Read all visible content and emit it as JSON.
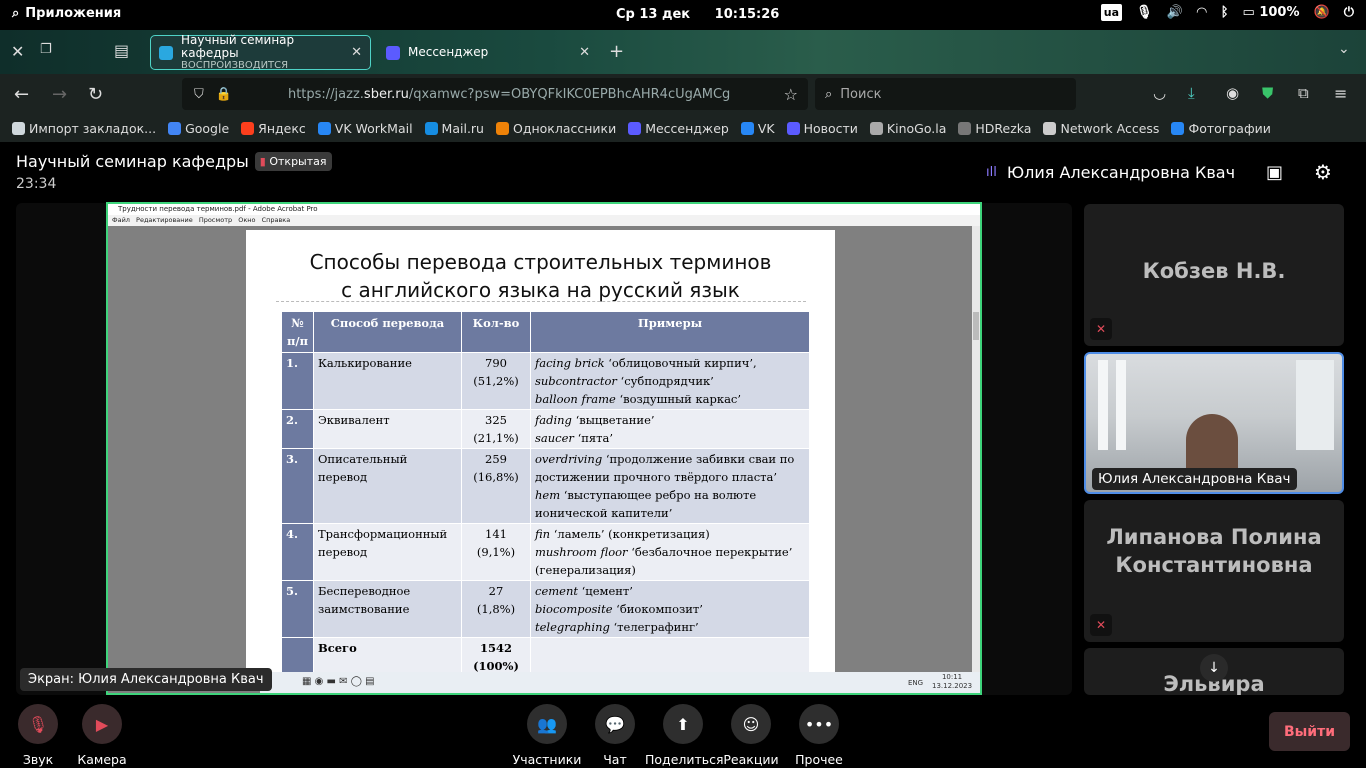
{
  "system": {
    "apps_label": "Приложения",
    "date": "Ср 13 дек",
    "time": "10:15:26",
    "keyboard": "ua",
    "battery": "100%"
  },
  "browser": {
    "tabs": [
      {
        "title": "Научный семинар кафедры",
        "subtitle": "ВОСПРОИЗВОДИТСЯ"
      },
      {
        "title": "Мессенджер",
        "subtitle": ""
      }
    ],
    "url_prefix": "https://jazz.",
    "url_domain": "sber.ru",
    "url_path": "/qxamwc?psw=OBYQFkIKC0EPBhcAHR4cUgAMCg",
    "search_placeholder": "Поиск",
    "bookmarks": [
      {
        "label": "Импорт закладок...",
        "color": "#cfd8dc"
      },
      {
        "label": "Google",
        "color": "#4285f4"
      },
      {
        "label": "Яндекс",
        "color": "#fc3f1d"
      },
      {
        "label": "VK WorkMail",
        "color": "#2787f5"
      },
      {
        "label": "Mail.ru",
        "color": "#168de2"
      },
      {
        "label": "Одноклассники",
        "color": "#ee8208"
      },
      {
        "label": "Мессенджер",
        "color": "#5b5bff"
      },
      {
        "label": "VK",
        "color": "#2787f5"
      },
      {
        "label": "Новости",
        "color": "#5b5bff"
      },
      {
        "label": "KinoGo.la",
        "color": "#aaaaaa"
      },
      {
        "label": "HDRezka",
        "color": "#777777"
      },
      {
        "label": "Network Access",
        "color": "#cccccc"
      },
      {
        "label": "Фотографии",
        "color": "#2787f5"
      }
    ]
  },
  "meeting": {
    "title": "Научный семинар кафедры",
    "badge": "Открытая",
    "elapsed": "23:34",
    "active_speaker": "Юлия Александровна Квач",
    "screen_label": "Экран: Юлия Александровна Квач"
  },
  "shared_doc": {
    "window_title": "Трудности перевода терминов.pdf - Adobe Acrobat Pro",
    "menu": "Файл Редактирование Просмотр Окно Справка",
    "slide_title_line1": "Способы перевода строительных терминов",
    "slide_title_line2": "с английского языка на русский язык",
    "headers": [
      "№ п/п",
      "Способ перевода",
      "Кол-во",
      "Примеры"
    ],
    "rows": [
      {
        "num": "1.",
        "method": "Калькирование",
        "count": "790",
        "percent": "(51,2%)",
        "examples": [
          [
            "facing brick",
            " ‘облицовочный кирпич’,"
          ],
          [
            "subcontractor",
            " ‘субподрядчик’"
          ],
          [
            "balloon frame",
            " ‘воздушный каркас’"
          ]
        ]
      },
      {
        "num": "2.",
        "method": "Эквивалент",
        "count": "325",
        "percent": "(21,1%)",
        "examples": [
          [
            "fading",
            " ‘выцветание’"
          ],
          [
            "saucer",
            " ‘пята’"
          ]
        ]
      },
      {
        "num": "3.",
        "method": "Описательный перевод",
        "count": "259",
        "percent": "(16,8%)",
        "examples": [
          [
            "overdriving",
            " ‘продолжение забивки сваи по достижении прочного твёрдого пласта’"
          ],
          [
            "hem",
            " ‘выступающее ребро на волюте ионической капители’"
          ]
        ]
      },
      {
        "num": "4.",
        "method": "Трансформационный перевод",
        "count": "141",
        "percent": "(9,1%)",
        "examples": [
          [
            "fin",
            " ‘ламель’ (конкретизация)"
          ],
          [
            "mushroom floor",
            " ‘безбалочное перекрытие’ (генерализация)"
          ]
        ]
      },
      {
        "num": "5.",
        "method": "Беспереводное заимствование",
        "count": "27",
        "percent": "(1,8%)",
        "examples": [
          [
            "cement",
            " ‘цемент’"
          ],
          [
            "biocomposite",
            " ‘биокомпозит’"
          ],
          [
            "telegraphing",
            " ‘телеграфинг’"
          ]
        ]
      },
      {
        "num": "",
        "method": "Всего",
        "count": "1542",
        "percent": "(100%)",
        "examples": []
      }
    ],
    "taskbar_lang": "ENG",
    "taskbar_time": "10:11",
    "taskbar_date": "13.12.2023"
  },
  "participants": [
    {
      "name": "Кобзев Н.В.",
      "muted": true
    },
    {
      "name": "Юлия Александровна Квач",
      "video": true
    },
    {
      "name": "Липанова Полина Константиновна",
      "muted": true
    },
    {
      "name": "Эльвира",
      "muted": false
    }
  ],
  "controls": [
    {
      "label": "Звук",
      "icon": "mic-off-icon",
      "state": "off"
    },
    {
      "label": "Камера",
      "icon": "camera-off-icon",
      "state": "off"
    },
    {
      "label": "Участники",
      "icon": "participants-icon"
    },
    {
      "label": "Чат",
      "icon": "chat-icon"
    },
    {
      "label": "Поделиться",
      "icon": "share-icon"
    },
    {
      "label": "Реакции",
      "icon": "reactions-icon"
    },
    {
      "label": "Прочее",
      "icon": "more-icon"
    }
  ],
  "leave_label": "Выйти"
}
